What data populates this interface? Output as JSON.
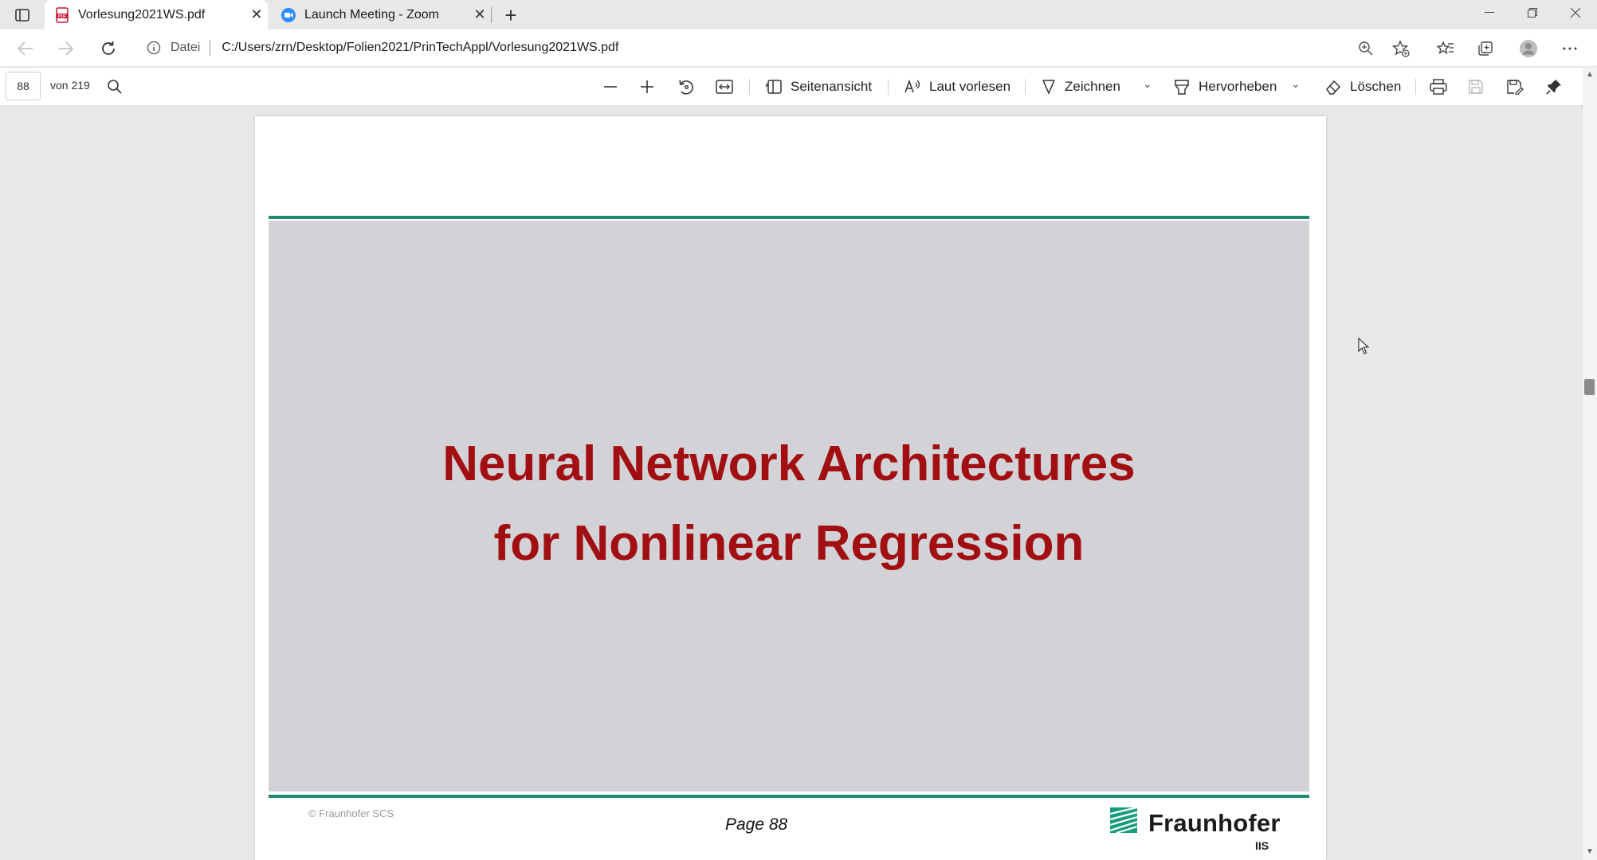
{
  "tabs": [
    {
      "title": "Vorlesung2021WS.pdf",
      "icon": "pdf-file-icon",
      "active": true
    },
    {
      "title": "Launch Meeting - Zoom",
      "icon": "zoom-camera-icon",
      "active": false
    }
  ],
  "address_bar": {
    "scheme_label": "Datei",
    "url": "C:/Users/zrn/Desktop/Folien2021/PrinTechAppl/Vorlesung2021WS.pdf"
  },
  "pdf_toolbar": {
    "current_page": "88",
    "total_pages": "von 219",
    "page_view": "Seitenansicht",
    "read_aloud": "Laut vorlesen",
    "draw": "Zeichnen",
    "highlight": "Hervorheben",
    "erase": "Löschen"
  },
  "slide": {
    "title_line1": "Neural Network Architectures",
    "title_line2": "for Nonlinear Regression",
    "copyright": "© Fraunhofer SCS",
    "page_label": "Page 88",
    "logo_name": "Fraunhofer",
    "logo_sub": "IIS"
  },
  "colors": {
    "accent_rule": "#1f8a6e",
    "title_red": "#a10f12",
    "slide_bg": "#d3d3d7"
  }
}
